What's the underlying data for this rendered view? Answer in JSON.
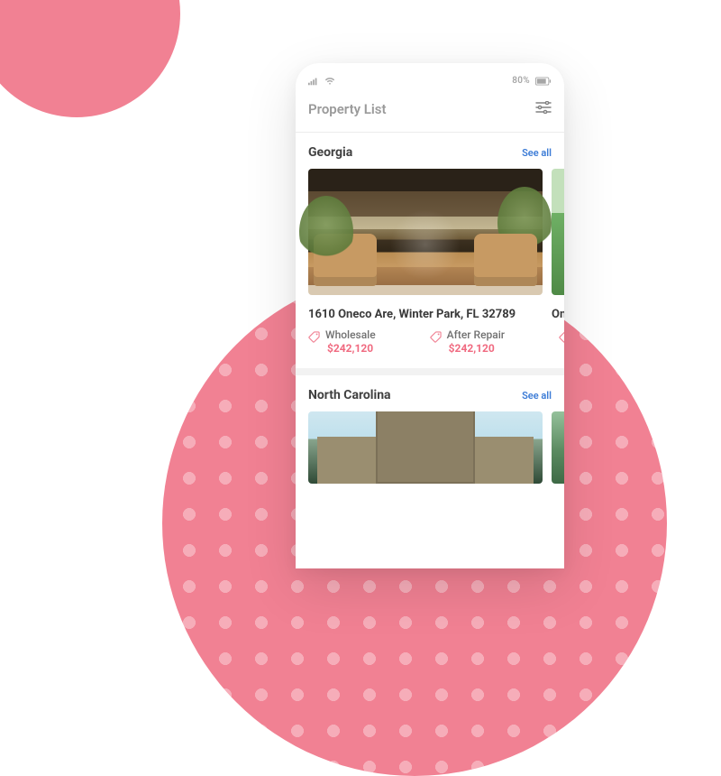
{
  "status": {
    "battery_text": "80%"
  },
  "header": {
    "title": "Property List"
  },
  "sections": [
    {
      "title": "Georgia",
      "see_all": "See all",
      "cards": [
        {
          "address": "1610 Oneco Are, Winter Park, FL 32789",
          "prices": [
            {
              "label": "Wholesale",
              "value": "$242,120"
            },
            {
              "label": "After Repair",
              "value": "$242,120"
            }
          ]
        },
        {
          "address_peek": "On"
        }
      ]
    },
    {
      "title": "North Carolina",
      "see_all": "See all"
    }
  ]
}
